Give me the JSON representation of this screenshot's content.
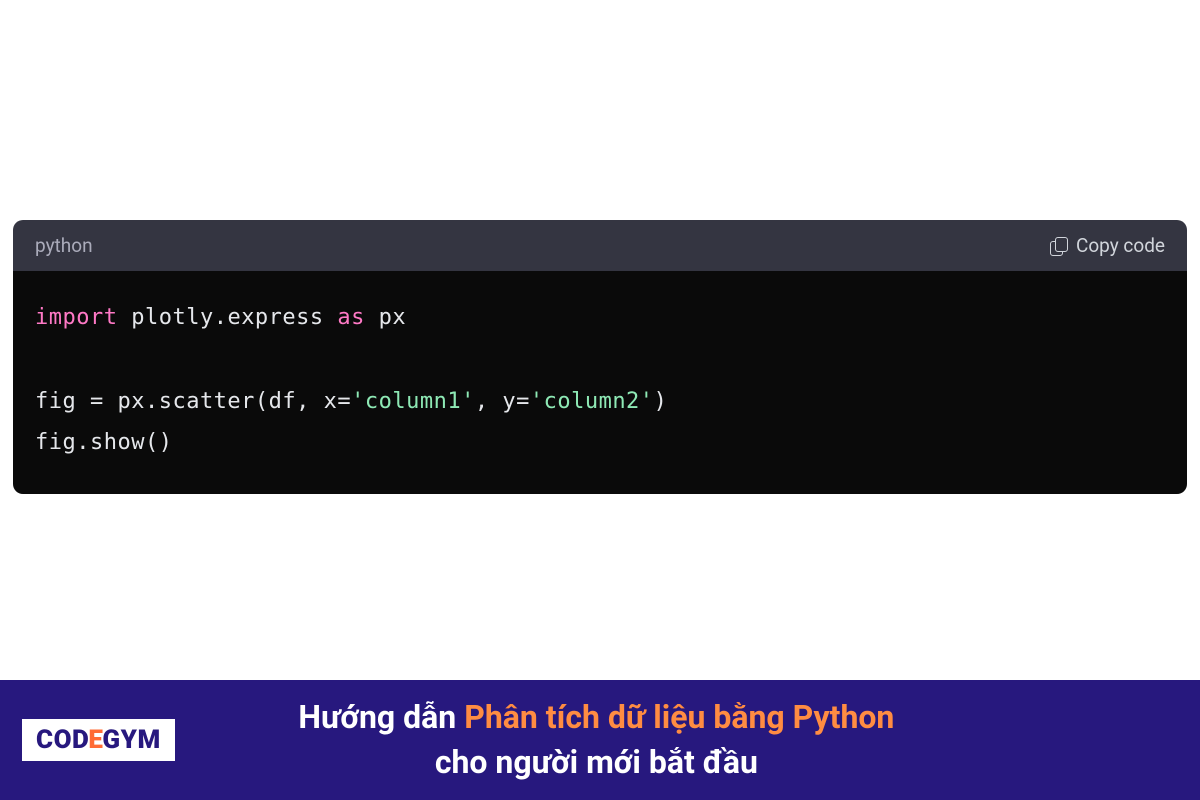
{
  "codeBlock": {
    "language": "python",
    "copyLabel": "Copy code",
    "tokens": {
      "import": "import",
      "module": " plotly.express ",
      "as": "as",
      "alias": " px",
      "line2a": "fig = px.scatter(df, x=",
      "str1": "'column1'",
      "line2b": ", y=",
      "str2": "'column2'",
      "line2c": ")",
      "line3": "fig.show()"
    }
  },
  "banner": {
    "logoPart1": "COD",
    "logoE": "E",
    "logoPart2": "GYM",
    "line1White": "Hướng dẫn ",
    "line1Orange": "Phân tích dữ liệu bằng Python",
    "line2": "cho người mới bắt đầu"
  }
}
